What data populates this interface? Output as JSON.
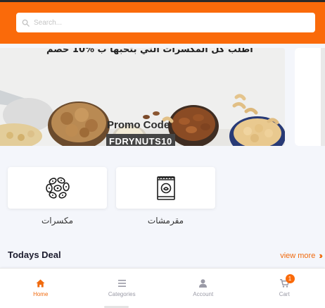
{
  "search": {
    "placeholder": "Search..."
  },
  "banner": {
    "arabic_headline": "اطلب كل المكسرات التي بتحبها ب %10 خصم",
    "promo_label": "Promo Code",
    "promo_code": "FDRYNUTS10"
  },
  "categories": [
    {
      "label": "مكسرات",
      "icon": "nuts-icon"
    },
    {
      "label": "مقرمشات",
      "icon": "snack-bag-icon"
    }
  ],
  "deals": {
    "title": "Todays Deal",
    "view_more": "view more"
  },
  "nav": {
    "items": [
      {
        "label": "Home",
        "icon": "home-icon",
        "active": true
      },
      {
        "label": "Categories",
        "icon": "menu-icon",
        "active": false
      },
      {
        "label": "Account",
        "icon": "user-icon",
        "active": false
      },
      {
        "label": "Cart",
        "icon": "cart-icon",
        "active": false
      }
    ],
    "cart_count": "1"
  },
  "colors": {
    "accent": "#fa6a0a",
    "background": "#f4f6fb"
  }
}
